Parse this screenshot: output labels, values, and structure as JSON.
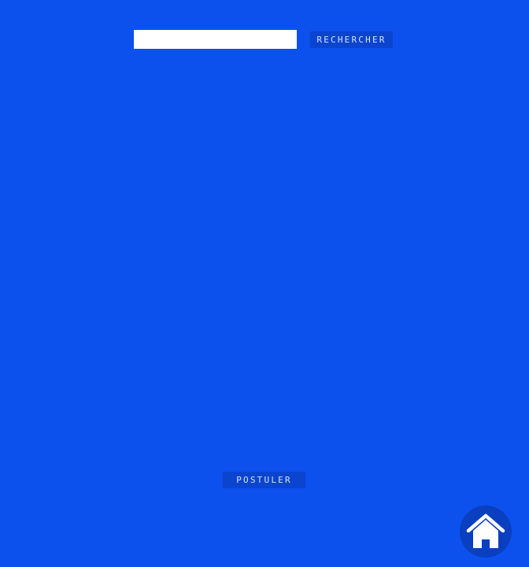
{
  "search": {
    "value": "",
    "placeholder": "",
    "button_label": "RECHERCHER"
  },
  "main": {
    "apply_label": "POSTULER"
  },
  "home": {
    "icon": "home-icon"
  },
  "colors": {
    "background": "#0c50ee",
    "button": "#0a44cf",
    "home_circle": "#0a3fbf",
    "text_light": "#d8e3ff"
  }
}
